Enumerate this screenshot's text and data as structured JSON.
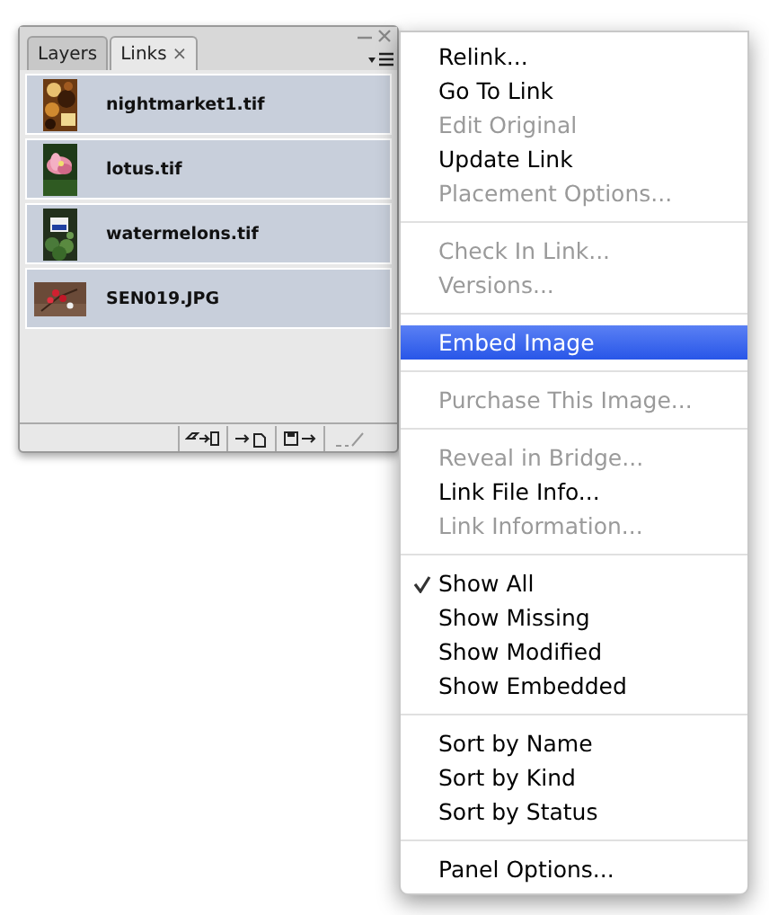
{
  "panel": {
    "tabs": [
      {
        "label": "Layers",
        "selected": false,
        "closable": false
      },
      {
        "label": "Links",
        "selected": true,
        "closable": true
      }
    ],
    "close_glyph": "×",
    "links": [
      {
        "name": "nightmarket1.tif"
      },
      {
        "name": "lotus.tif"
      },
      {
        "name": "watermelons.tif"
      },
      {
        "name": "SEN019.JPG"
      }
    ]
  },
  "menu": {
    "groups": [
      [
        {
          "label": "Relink...",
          "disabled": false,
          "checked": false,
          "selected": false
        },
        {
          "label": "Go To Link",
          "disabled": false,
          "checked": false,
          "selected": false
        },
        {
          "label": "Edit Original",
          "disabled": true,
          "checked": false,
          "selected": false
        },
        {
          "label": "Update Link",
          "disabled": false,
          "checked": false,
          "selected": false
        },
        {
          "label": "Placement Options...",
          "disabled": true,
          "checked": false,
          "selected": false
        }
      ],
      [
        {
          "label": "Check In Link...",
          "disabled": true,
          "checked": false,
          "selected": false
        },
        {
          "label": "Versions...",
          "disabled": true,
          "checked": false,
          "selected": false
        }
      ],
      [
        {
          "label": "Embed Image",
          "disabled": false,
          "checked": false,
          "selected": true
        }
      ],
      [
        {
          "label": "Purchase This Image...",
          "disabled": true,
          "checked": false,
          "selected": false
        }
      ],
      [
        {
          "label": "Reveal in Bridge...",
          "disabled": true,
          "checked": false,
          "selected": false
        },
        {
          "label": "Link File Info...",
          "disabled": false,
          "checked": false,
          "selected": false
        },
        {
          "label": "Link Information...",
          "disabled": true,
          "checked": false,
          "selected": false
        }
      ],
      [
        {
          "label": "Show All",
          "disabled": false,
          "checked": true,
          "selected": false
        },
        {
          "label": "Show Missing",
          "disabled": false,
          "checked": false,
          "selected": false
        },
        {
          "label": "Show Modified",
          "disabled": false,
          "checked": false,
          "selected": false
        },
        {
          "label": "Show Embedded",
          "disabled": false,
          "checked": false,
          "selected": false
        }
      ],
      [
        {
          "label": "Sort by Name",
          "disabled": false,
          "checked": false,
          "selected": false
        },
        {
          "label": "Sort by Kind",
          "disabled": false,
          "checked": false,
          "selected": false
        },
        {
          "label": "Sort by Status",
          "disabled": false,
          "checked": false,
          "selected": false
        }
      ],
      [
        {
          "label": "Panel Options...",
          "disabled": false,
          "checked": false,
          "selected": false
        }
      ]
    ]
  }
}
